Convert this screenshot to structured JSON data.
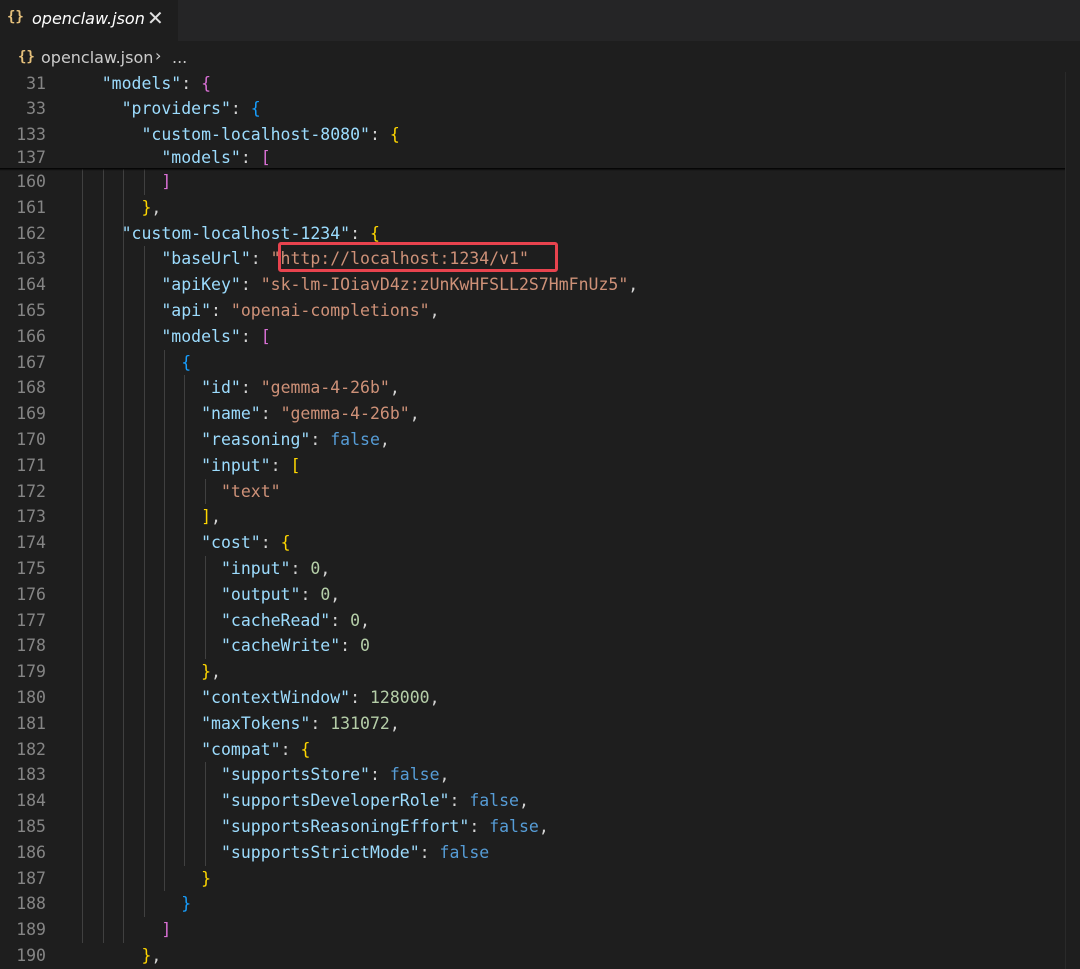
{
  "tab": {
    "icon": "json-braces-icon",
    "braces": "{}",
    "title": "openclaw.json",
    "close": "✕"
  },
  "breadcrumb": {
    "braces": "{}",
    "file": "openclaw.json",
    "separator": "›",
    "more": "..."
  },
  "colors": {
    "background": "#1e1e1e",
    "tabbar": "#252526",
    "key": "#9cdcfe",
    "string": "#ce9178",
    "number": "#b5cea8",
    "boolean": "#569cd6",
    "highlight": "#e8434e"
  },
  "sticky_lines": [
    {
      "n": "31",
      "indent": "    ",
      "tokens": [
        [
          "k",
          "\"models\""
        ],
        [
          "p",
          ": "
        ],
        [
          "br2",
          "{"
        ]
      ]
    },
    {
      "n": "33",
      "indent": "      ",
      "tokens": [
        [
          "k",
          "\"providers\""
        ],
        [
          "p",
          ": "
        ],
        [
          "br3",
          "{"
        ]
      ]
    },
    {
      "n": "133",
      "indent": "        ",
      "tokens": [
        [
          "k",
          "\"custom-localhost-8080\""
        ],
        [
          "p",
          ": "
        ],
        [
          "br1",
          "{"
        ]
      ]
    },
    {
      "n": "137",
      "indent": "          ",
      "tokens": [
        [
          "k",
          "\"models\""
        ],
        [
          "p",
          ": "
        ],
        [
          "br2",
          "["
        ]
      ]
    }
  ],
  "lines": [
    {
      "n": "160",
      "indent": "          ",
      "tokens": [
        [
          "br2",
          "]"
        ]
      ]
    },
    {
      "n": "161",
      "indent": "        ",
      "tokens": [
        [
          "br1",
          "}"
        ],
        [
          "p",
          ","
        ]
      ]
    },
    {
      "n": "162",
      "indent": "      ",
      "tokens": [
        [
          "k",
          "\"custom-localhost-1234\""
        ],
        [
          "p",
          ": "
        ],
        [
          "br1",
          "{"
        ]
      ]
    },
    {
      "n": "163",
      "indent": "          ",
      "tokens": [
        [
          "k",
          "\"baseUrl\""
        ],
        [
          "p",
          ": "
        ],
        [
          "s",
          "\"http://localhost:1234/v1\""
        ]
      ]
    },
    {
      "n": "164",
      "indent": "          ",
      "tokens": [
        [
          "k",
          "\"apiKey\""
        ],
        [
          "p",
          ": "
        ],
        [
          "s",
          "\"sk-lm-IOiavD4z:zUnKwHFSLL2S7HmFnUz5\""
        ],
        [
          "p",
          ","
        ]
      ]
    },
    {
      "n": "165",
      "indent": "          ",
      "tokens": [
        [
          "k",
          "\"api\""
        ],
        [
          "p",
          ": "
        ],
        [
          "s",
          "\"openai-completions\""
        ],
        [
          "p",
          ","
        ]
      ]
    },
    {
      "n": "166",
      "indent": "          ",
      "tokens": [
        [
          "k",
          "\"models\""
        ],
        [
          "p",
          ": "
        ],
        [
          "br2",
          "["
        ]
      ]
    },
    {
      "n": "167",
      "indent": "            ",
      "tokens": [
        [
          "br3",
          "{"
        ]
      ]
    },
    {
      "n": "168",
      "indent": "              ",
      "tokens": [
        [
          "k",
          "\"id\""
        ],
        [
          "p",
          ": "
        ],
        [
          "s",
          "\"gemma-4-26b\""
        ],
        [
          "p",
          ","
        ]
      ]
    },
    {
      "n": "169",
      "indent": "              ",
      "tokens": [
        [
          "k",
          "\"name\""
        ],
        [
          "p",
          ": "
        ],
        [
          "s",
          "\"gemma-4-26b\""
        ],
        [
          "p",
          ","
        ]
      ]
    },
    {
      "n": "170",
      "indent": "              ",
      "tokens": [
        [
          "k",
          "\"reasoning\""
        ],
        [
          "p",
          ": "
        ],
        [
          "b",
          "false"
        ],
        [
          "p",
          ","
        ]
      ]
    },
    {
      "n": "171",
      "indent": "              ",
      "tokens": [
        [
          "k",
          "\"input\""
        ],
        [
          "p",
          ": "
        ],
        [
          "br1",
          "["
        ]
      ]
    },
    {
      "n": "172",
      "indent": "                ",
      "tokens": [
        [
          "s",
          "\"text\""
        ]
      ]
    },
    {
      "n": "173",
      "indent": "              ",
      "tokens": [
        [
          "br1",
          "]"
        ],
        [
          "p",
          ","
        ]
      ]
    },
    {
      "n": "174",
      "indent": "              ",
      "tokens": [
        [
          "k",
          "\"cost\""
        ],
        [
          "p",
          ": "
        ],
        [
          "br1",
          "{"
        ]
      ]
    },
    {
      "n": "175",
      "indent": "                ",
      "tokens": [
        [
          "k",
          "\"input\""
        ],
        [
          "p",
          ": "
        ],
        [
          "n",
          "0"
        ],
        [
          "p",
          ","
        ]
      ]
    },
    {
      "n": "176",
      "indent": "                ",
      "tokens": [
        [
          "k",
          "\"output\""
        ],
        [
          "p",
          ": "
        ],
        [
          "n",
          "0"
        ],
        [
          "p",
          ","
        ]
      ]
    },
    {
      "n": "177",
      "indent": "                ",
      "tokens": [
        [
          "k",
          "\"cacheRead\""
        ],
        [
          "p",
          ": "
        ],
        [
          "n",
          "0"
        ],
        [
          "p",
          ","
        ]
      ]
    },
    {
      "n": "178",
      "indent": "                ",
      "tokens": [
        [
          "k",
          "\"cacheWrite\""
        ],
        [
          "p",
          ": "
        ],
        [
          "n",
          "0"
        ]
      ]
    },
    {
      "n": "179",
      "indent": "              ",
      "tokens": [
        [
          "br1",
          "}"
        ],
        [
          "p",
          ","
        ]
      ]
    },
    {
      "n": "180",
      "indent": "              ",
      "tokens": [
        [
          "k",
          "\"contextWindow\""
        ],
        [
          "p",
          ": "
        ],
        [
          "n",
          "128000"
        ],
        [
          "p",
          ","
        ]
      ]
    },
    {
      "n": "181",
      "indent": "              ",
      "tokens": [
        [
          "k",
          "\"maxTokens\""
        ],
        [
          "p",
          ": "
        ],
        [
          "n",
          "131072"
        ],
        [
          "p",
          ","
        ]
      ]
    },
    {
      "n": "182",
      "indent": "              ",
      "tokens": [
        [
          "k",
          "\"compat\""
        ],
        [
          "p",
          ": "
        ],
        [
          "br1",
          "{"
        ]
      ]
    },
    {
      "n": "183",
      "indent": "                ",
      "tokens": [
        [
          "k",
          "\"supportsStore\""
        ],
        [
          "p",
          ": "
        ],
        [
          "b",
          "false"
        ],
        [
          "p",
          ","
        ]
      ]
    },
    {
      "n": "184",
      "indent": "                ",
      "tokens": [
        [
          "k",
          "\"supportsDeveloperRole\""
        ],
        [
          "p",
          ": "
        ],
        [
          "b",
          "false"
        ],
        [
          "p",
          ","
        ]
      ]
    },
    {
      "n": "185",
      "indent": "                ",
      "tokens": [
        [
          "k",
          "\"supportsReasoningEffort\""
        ],
        [
          "p",
          ": "
        ],
        [
          "b",
          "false"
        ],
        [
          "p",
          ","
        ]
      ]
    },
    {
      "n": "186",
      "indent": "                ",
      "tokens": [
        [
          "k",
          "\"supportsStrictMode\""
        ],
        [
          "p",
          ": "
        ],
        [
          "b",
          "false"
        ]
      ]
    },
    {
      "n": "187",
      "indent": "              ",
      "tokens": [
        [
          "br1",
          "}"
        ]
      ]
    },
    {
      "n": "188",
      "indent": "            ",
      "tokens": [
        [
          "br3",
          "}"
        ]
      ]
    },
    {
      "n": "189",
      "indent": "          ",
      "tokens": [
        [
          "br2",
          "]"
        ]
      ]
    },
    {
      "n": "190",
      "indent": "        ",
      "tokens": [
        [
          "br1",
          "}"
        ],
        [
          "p",
          ","
        ]
      ]
    }
  ]
}
